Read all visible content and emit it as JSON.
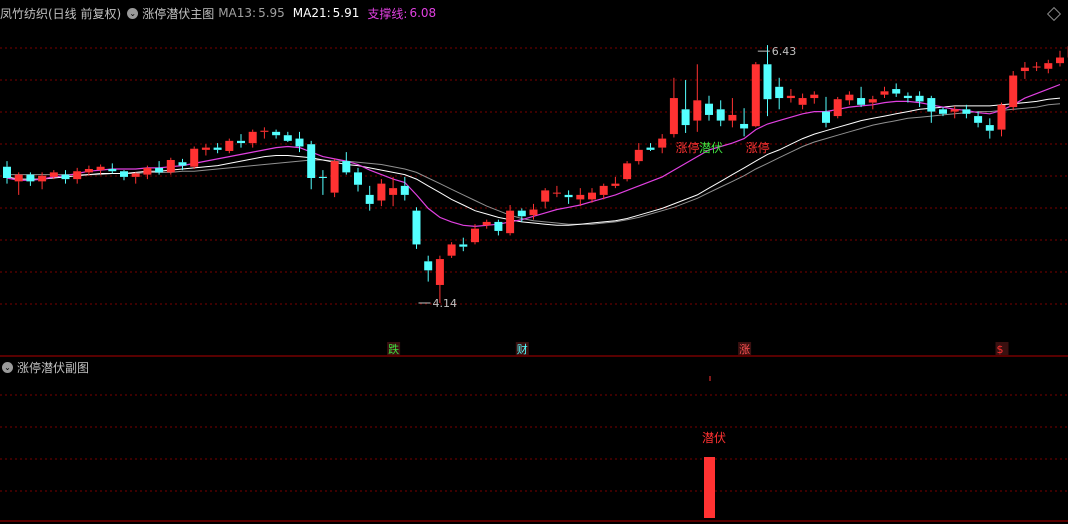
{
  "header": {
    "title": "凤竹纺织(日线 前复权)",
    "indicator": "涨停潜伏主图",
    "ma13_label": "MA13:",
    "ma13_value": "5.95",
    "ma21_label": "MA21:",
    "ma21_value": "5.91",
    "support_label": "支撑线:",
    "support_value": "6.08"
  },
  "sub_header": {
    "title": "涨停潜伏副图"
  },
  "colors": {
    "up": "#ff3232",
    "down": "#54ffff",
    "ma13": "#ffffff",
    "ma21": "#c0c0c0",
    "support": "#e040e0",
    "grid": "#7a0000",
    "text": "#c0c0c0",
    "bg": "#000000"
  },
  "chart_data": [
    {
      "type": "candlestick",
      "title": "涨停潜伏主图",
      "ylim": [
        3.9,
        6.6
      ],
      "annotations": [
        {
          "text": "6.43",
          "x_index": 64,
          "y": 6.43
        },
        {
          "text": "4.14",
          "x_index": 35,
          "y": 4.14
        },
        {
          "text": "涨停",
          "x_index": 58,
          "y": 5.4
        },
        {
          "text": "潜伏",
          "x_index": 60,
          "y": 5.38
        },
        {
          "text": "涨停",
          "x_index": 64,
          "y": 5.45
        }
      ],
      "event_markers": [
        {
          "text": "跌",
          "x_index": 33
        },
        {
          "text": "财",
          "x_index": 44
        },
        {
          "text": "涨",
          "x_index": 63
        },
        {
          "text": "$",
          "x_index": 85
        }
      ],
      "ohlc": [
        [
          5.35,
          5.4,
          5.2,
          5.25
        ],
        [
          5.22,
          5.3,
          5.1,
          5.28
        ],
        [
          5.28,
          5.3,
          5.18,
          5.22
        ],
        [
          5.22,
          5.3,
          5.15,
          5.27
        ],
        [
          5.26,
          5.32,
          5.24,
          5.3
        ],
        [
          5.28,
          5.32,
          5.2,
          5.24
        ],
        [
          5.24,
          5.34,
          5.2,
          5.31
        ],
        [
          5.3,
          5.36,
          5.27,
          5.33
        ],
        [
          5.32,
          5.37,
          5.28,
          5.35
        ],
        [
          5.33,
          5.38,
          5.29,
          5.31
        ],
        [
          5.31,
          5.32,
          5.23,
          5.26
        ],
        [
          5.26,
          5.3,
          5.2,
          5.29
        ],
        [
          5.28,
          5.36,
          5.24,
          5.34
        ],
        [
          5.34,
          5.4,
          5.28,
          5.3
        ],
        [
          5.3,
          5.43,
          5.28,
          5.41
        ],
        [
          5.39,
          5.42,
          5.32,
          5.36
        ],
        [
          5.35,
          5.53,
          5.33,
          5.51
        ],
        [
          5.5,
          5.55,
          5.45,
          5.52
        ],
        [
          5.52,
          5.56,
          5.47,
          5.5
        ],
        [
          5.49,
          5.6,
          5.47,
          5.58
        ],
        [
          5.58,
          5.64,
          5.52,
          5.56
        ],
        [
          5.56,
          5.68,
          5.52,
          5.66
        ],
        [
          5.66,
          5.7,
          5.6,
          5.67
        ],
        [
          5.66,
          5.68,
          5.6,
          5.63
        ],
        [
          5.63,
          5.66,
          5.57,
          5.58
        ],
        [
          5.6,
          5.66,
          5.48,
          5.53
        ],
        [
          5.55,
          5.58,
          5.15,
          5.25
        ],
        [
          5.26,
          5.32,
          5.1,
          5.25
        ],
        [
          5.12,
          5.42,
          5.08,
          5.4
        ],
        [
          5.4,
          5.48,
          5.28,
          5.3
        ],
        [
          5.3,
          5.34,
          5.13,
          5.19
        ],
        [
          5.1,
          5.18,
          4.96,
          5.02
        ],
        [
          5.05,
          5.24,
          5.0,
          5.2
        ],
        [
          5.1,
          5.26,
          5.0,
          5.16
        ],
        [
          5.18,
          5.26,
          5.05,
          5.1
        ],
        [
          4.96,
          4.99,
          4.62,
          4.66
        ],
        [
          4.51,
          4.56,
          4.33,
          4.43
        ],
        [
          4.3,
          4.56,
          4.14,
          4.53
        ],
        [
          4.56,
          4.68,
          4.54,
          4.66
        ],
        [
          4.66,
          4.72,
          4.6,
          4.64
        ],
        [
          4.68,
          4.84,
          4.66,
          4.8
        ],
        [
          4.83,
          4.88,
          4.8,
          4.86
        ],
        [
          4.86,
          4.88,
          4.74,
          4.78
        ],
        [
          4.76,
          5.01,
          4.74,
          4.96
        ],
        [
          4.96,
          4.98,
          4.86,
          4.91
        ],
        [
          4.92,
          5.02,
          4.88,
          4.97
        ],
        [
          5.04,
          5.16,
          4.98,
          5.14
        ],
        [
          5.12,
          5.18,
          5.08,
          5.12
        ],
        [
          5.1,
          5.14,
          5.02,
          5.08
        ],
        [
          5.06,
          5.16,
          5.0,
          5.1
        ],
        [
          5.06,
          5.16,
          5.03,
          5.12
        ],
        [
          5.1,
          5.2,
          5.06,
          5.18
        ],
        [
          5.18,
          5.26,
          5.16,
          5.2
        ],
        [
          5.24,
          5.4,
          5.22,
          5.38
        ],
        [
          5.4,
          5.56,
          5.37,
          5.5
        ],
        [
          5.52,
          5.56,
          5.49,
          5.5
        ],
        [
          5.52,
          5.64,
          5.47,
          5.6
        ],
        [
          5.64,
          6.14,
          5.61,
          5.96
        ],
        [
          5.86,
          6.12,
          5.65,
          5.72
        ],
        [
          5.76,
          6.26,
          5.66,
          5.94
        ],
        [
          5.91,
          5.98,
          5.76,
          5.81
        ],
        [
          5.86,
          5.94,
          5.71,
          5.76
        ],
        [
          5.76,
          5.96,
          5.7,
          5.81
        ],
        [
          5.73,
          5.87,
          5.62,
          5.69
        ],
        [
          5.71,
          6.28,
          5.7,
          6.26
        ],
        [
          6.26,
          6.43,
          5.8,
          5.95
        ],
        [
          6.06,
          6.14,
          5.86,
          5.96
        ],
        [
          5.96,
          6.04,
          5.92,
          5.98
        ],
        [
          5.9,
          6.0,
          5.86,
          5.96
        ],
        [
          5.96,
          6.02,
          5.91,
          5.99
        ],
        [
          5.84,
          5.97,
          5.7,
          5.74
        ],
        [
          5.8,
          5.97,
          5.78,
          5.95
        ],
        [
          5.94,
          6.02,
          5.9,
          5.99
        ],
        [
          5.96,
          6.06,
          5.88,
          5.9
        ],
        [
          5.92,
          5.98,
          5.86,
          5.95
        ],
        [
          5.99,
          6.06,
          5.96,
          6.02
        ],
        [
          6.04,
          6.09,
          5.97,
          6.0
        ],
        [
          5.98,
          6.01,
          5.92,
          5.96
        ],
        [
          5.98,
          6.02,
          5.88,
          5.93
        ],
        [
          5.96,
          5.98,
          5.74,
          5.84
        ],
        [
          5.86,
          5.88,
          5.8,
          5.82
        ],
        [
          5.84,
          5.89,
          5.78,
          5.86
        ],
        [
          5.86,
          5.9,
          5.78,
          5.82
        ],
        [
          5.8,
          5.84,
          5.7,
          5.74
        ],
        [
          5.72,
          5.78,
          5.6,
          5.67
        ],
        [
          5.68,
          5.92,
          5.62,
          5.9
        ],
        [
          5.88,
          6.2,
          5.85,
          6.16
        ],
        [
          6.2,
          6.28,
          6.13,
          6.23
        ],
        [
          6.24,
          6.28,
          6.2,
          6.24
        ],
        [
          6.22,
          6.3,
          6.18,
          6.27
        ],
        [
          6.27,
          6.38,
          6.24,
          6.32
        ],
        [
          6.32,
          6.44,
          6.28,
          6.42
        ]
      ],
      "ma13": [
        5.26,
        5.24,
        5.24,
        5.24,
        5.25,
        5.26,
        5.27,
        5.28,
        5.29,
        5.29,
        5.29,
        5.3,
        5.31,
        5.31,
        5.32,
        5.33,
        5.34,
        5.35,
        5.36,
        5.38,
        5.4,
        5.42,
        5.44,
        5.45,
        5.45,
        5.44,
        5.43,
        5.41,
        5.39,
        5.37,
        5.36,
        5.34,
        5.32,
        5.3,
        5.28,
        5.24,
        5.18,
        5.12,
        5.06,
        5.01,
        4.96,
        4.93,
        4.9,
        4.88,
        4.86,
        4.85,
        4.84,
        4.83,
        4.83,
        4.84,
        4.85,
        4.86,
        4.87,
        4.89,
        4.92,
        4.95,
        4.98,
        5.02,
        5.06,
        5.1,
        5.16,
        5.22,
        5.28,
        5.34,
        5.4,
        5.46,
        5.5,
        5.55,
        5.6,
        5.64,
        5.67,
        5.7,
        5.73,
        5.76,
        5.78,
        5.8,
        5.82,
        5.84,
        5.86,
        5.87,
        5.88,
        5.89,
        5.89,
        5.89,
        5.89,
        5.9,
        5.91,
        5.92,
        5.93,
        5.95,
        5.96
      ],
      "ma21": [
        5.28,
        5.28,
        5.28,
        5.28,
        5.28,
        5.28,
        5.28,
        5.28,
        5.28,
        5.29,
        5.29,
        5.29,
        5.3,
        5.3,
        5.3,
        5.31,
        5.31,
        5.32,
        5.33,
        5.34,
        5.35,
        5.36,
        5.37,
        5.38,
        5.39,
        5.4,
        5.41,
        5.41,
        5.4,
        5.4,
        5.39,
        5.38,
        5.37,
        5.35,
        5.33,
        5.3,
        5.25,
        5.2,
        5.15,
        5.1,
        5.05,
        5.0,
        4.96,
        4.92,
        4.89,
        4.87,
        4.86,
        4.85,
        4.84,
        4.84,
        4.84,
        4.85,
        4.86,
        4.88,
        4.9,
        4.93,
        4.96,
        4.99,
        5.03,
        5.07,
        5.12,
        5.17,
        5.22,
        5.27,
        5.33,
        5.38,
        5.43,
        5.48,
        5.53,
        5.57,
        5.6,
        5.63,
        5.66,
        5.69,
        5.72,
        5.74,
        5.76,
        5.78,
        5.79,
        5.8,
        5.81,
        5.82,
        5.83,
        5.84,
        5.84,
        5.85,
        5.86,
        5.87,
        5.88,
        5.9,
        5.91
      ],
      "support": [
        5.25,
        5.23,
        5.23,
        5.24,
        5.26,
        5.27,
        5.29,
        5.31,
        5.32,
        5.33,
        5.33,
        5.33,
        5.34,
        5.34,
        5.35,
        5.36,
        5.38,
        5.4,
        5.42,
        5.44,
        5.46,
        5.48,
        5.5,
        5.52,
        5.53,
        5.52,
        5.48,
        5.44,
        5.42,
        5.4,
        5.37,
        5.32,
        5.28,
        5.24,
        5.21,
        5.1,
        4.98,
        4.9,
        4.86,
        4.83,
        4.82,
        4.83,
        4.84,
        4.86,
        4.88,
        4.91,
        4.94,
        4.97,
        4.99,
        5.01,
        5.04,
        5.07,
        5.1,
        5.14,
        5.18,
        5.22,
        5.26,
        5.32,
        5.38,
        5.44,
        5.5,
        5.53,
        5.56,
        5.6,
        5.68,
        5.73,
        5.76,
        5.79,
        5.82,
        5.84,
        5.84,
        5.86,
        5.88,
        5.89,
        5.9,
        5.92,
        5.93,
        5.93,
        5.92,
        5.9,
        5.88,
        5.86,
        5.85,
        5.83,
        5.82,
        5.85,
        5.9,
        5.96,
        6.0,
        6.04,
        6.08
      ]
    },
    {
      "type": "bar",
      "title": "涨停潜伏副图",
      "annotations": [
        {
          "text": "潜伏",
          "x_index": 60
        }
      ],
      "bars": [
        {
          "x_index": 60,
          "value": 1
        }
      ]
    }
  ]
}
